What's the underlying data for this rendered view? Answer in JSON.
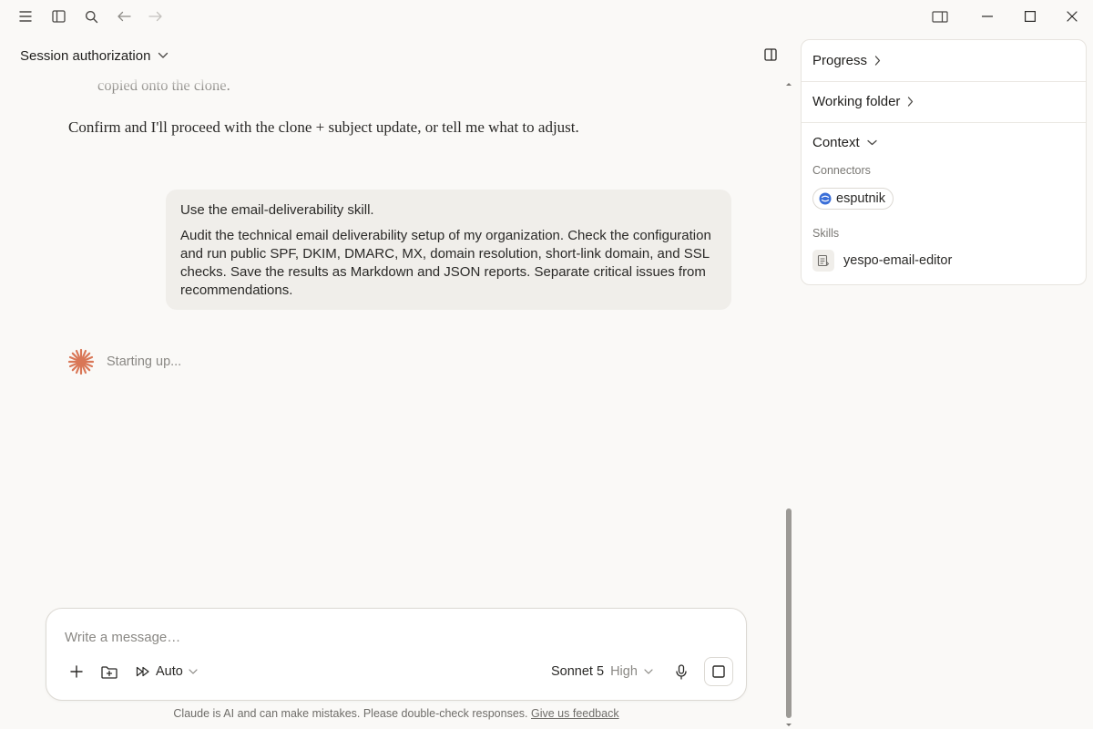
{
  "header": {
    "session_title": "Session authorization"
  },
  "conversation": {
    "faded_line": "copied onto the clone.",
    "assistant_text": "Confirm and I'll proceed with the clone + subject update, or tell me what to adjust.",
    "user_message": {
      "line1": "Use the email-deliverability skill.",
      "line2": "Audit the technical email deliverability setup of my  organization. Check the configuration and run public SPF, DKIM, DMARC, MX, domain resolution, short-link domain, and SSL checks. Save the results as Markdown and JSON reports. Separate critical issues from recommendations."
    },
    "status_text": "Starting up..."
  },
  "composer": {
    "placeholder": "Write a message…",
    "mode_label": "Auto",
    "model_name": "Sonnet 5",
    "effort_level": "High"
  },
  "footer": {
    "disclaimer": "Claude is AI and can make mistakes. Please double-check responses.",
    "feedback_link": "Give us feedback"
  },
  "side_panel": {
    "progress_label": "Progress",
    "working_folder_label": "Working folder",
    "context_label": "Context",
    "connectors_heading": "Connectors",
    "connector_name": "esputnik",
    "skills_heading": "Skills",
    "skill_name": "yespo-email-editor"
  },
  "colors": {
    "background": "#faf9f7",
    "accent_spark": "#d97757",
    "connector_blue": "#3b6fd8"
  }
}
